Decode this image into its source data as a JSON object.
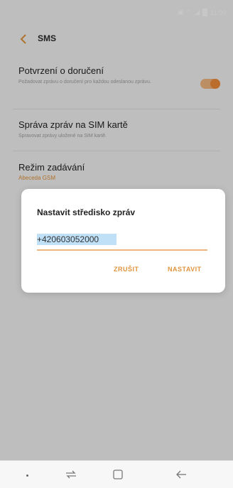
{
  "status_bar": {
    "time": "11:00"
  },
  "header": {
    "title": "SMS"
  },
  "settings": [
    {
      "title": "Potvrzení o doručení",
      "subtitle": "Požadovat zprávu o doručení pro každou odeslanou zprávu."
    },
    {
      "title": "Správa zpráv na SIM kartě",
      "subtitle": "Spravovat zprávy uložené na SIM kartě."
    },
    {
      "title": "Režim zadávání",
      "value": "Abeceda GSM"
    }
  ],
  "dialog": {
    "title": "Nastavit středisko zpráv",
    "input_value": "+420603052000",
    "cancel_label": "ZRUŠIT",
    "confirm_label": "NASTAVIT"
  },
  "colors": {
    "accent": "#e0943d",
    "toggle_on": "#f08c3c",
    "dialog_bg": "#ffffff",
    "screen_bg": "#f4f4f4"
  },
  "icons": {
    "back": "chevron-left-icon",
    "recents": "recent-apps-icon",
    "home": "home-square-icon",
    "nav_back": "back-arrow-icon"
  }
}
